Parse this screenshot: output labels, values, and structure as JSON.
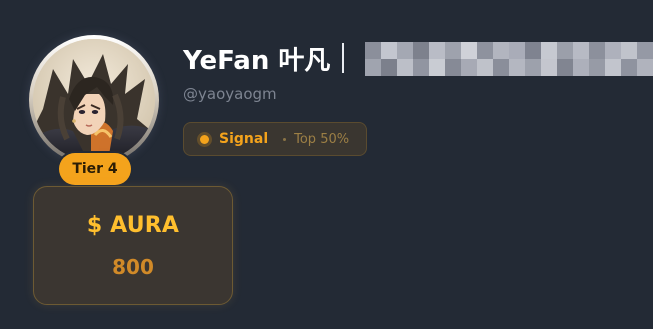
{
  "profile": {
    "display_name": "YeFan 叶凡",
    "handle": "@yaoyaogm",
    "tier_label": "Tier 4",
    "avatar_icon": "anime-portrait-avatar"
  },
  "signal": {
    "label": "Signal",
    "rank": "Top 50%",
    "dot_color": "#f4a31c"
  },
  "aura": {
    "title": "$ AURA",
    "value": "800"
  },
  "colors": {
    "background": "#232a35",
    "accent": "#f4a31c",
    "aura_title": "#ffbf2e",
    "aura_value": "#d18a28"
  },
  "redacted_name_tiles": [
    "#8b8f9b",
    "#c3c6cf",
    "#a4a8b3",
    "#7d818d",
    "#b9bcc6",
    "#9ea2ad",
    "#cfd1d8",
    "#8e929e",
    "#b2b5bf",
    "#a9acb8",
    "#7f8390",
    "#c6c9d1",
    "#9b9faa",
    "#b7bac4",
    "#8c909c",
    "#aeb1bc",
    "#c0c3cb",
    "#9599a5",
    "#a0a4af",
    "#7c808c",
    "#bcbfc8",
    "#9195a1",
    "#c9ccd3",
    "#868a96",
    "#a7aab5",
    "#bfc2ca",
    "#8a8e9a",
    "#b4b7c1",
    "#9da1ac",
    "#c4c6ce",
    "#818591",
    "#adb0bb",
    "#979ba6",
    "#c2c5cd",
    "#8f939f",
    "#b0b3bd"
  ]
}
